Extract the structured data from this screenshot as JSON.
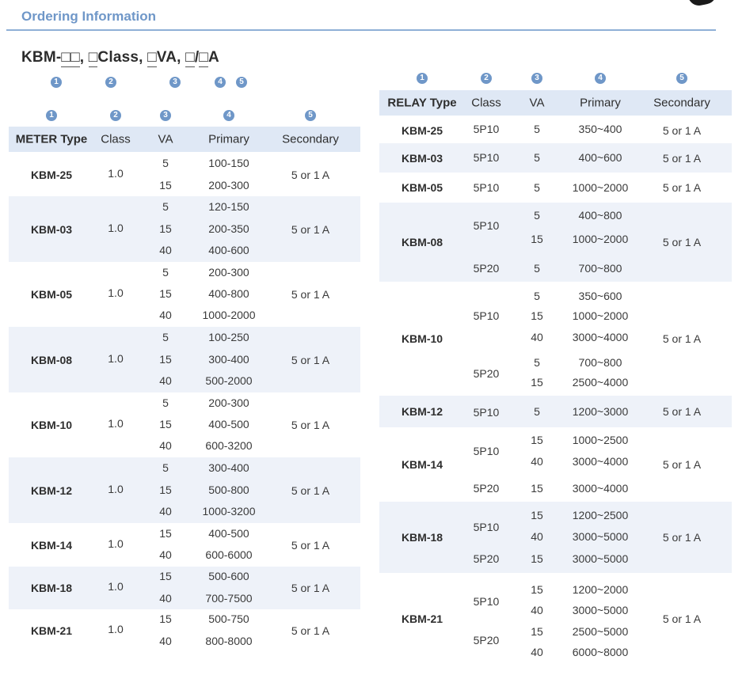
{
  "section_title": "Ordering Information",
  "code": {
    "prefix": "KBM-",
    "boxes_1": "□□",
    "sep_1": ", ",
    "box_2": "□",
    "suffix_2": "Class, ",
    "box_3": "□",
    "suffix_3": "VA, ",
    "box_4": "□",
    "slash": "/",
    "box_5": "□",
    "suffix_5": "A"
  },
  "markers": [
    "1",
    "2",
    "3",
    "4",
    "5"
  ],
  "meter": {
    "headers": [
      "METER Type",
      "Class",
      "VA",
      "Primary",
      "Secondary"
    ],
    "rows": [
      {
        "type": "KBM-25",
        "class": "1.0",
        "va": [
          "5",
          "15"
        ],
        "primary": [
          "100-150",
          "200-300"
        ],
        "secondary": "5 or 1 A"
      },
      {
        "type": "KBM-03",
        "class": "1.0",
        "va": [
          "5",
          "15",
          "40"
        ],
        "primary": [
          "120-150",
          "200-350",
          "400-600"
        ],
        "secondary": "5 or 1 A"
      },
      {
        "type": "KBM-05",
        "class": "1.0",
        "va": [
          "5",
          "15",
          "40"
        ],
        "primary": [
          "200-300",
          "400-800",
          "1000-2000"
        ],
        "secondary": "5 or 1 A"
      },
      {
        "type": "KBM-08",
        "class": "1.0",
        "va": [
          "5",
          "15",
          "40"
        ],
        "primary": [
          "100-250",
          "300-400",
          "500-2000"
        ],
        "secondary": "5 or 1 A"
      },
      {
        "type": "KBM-10",
        "class": "1.0",
        "va": [
          "5",
          "15",
          "40"
        ],
        "primary": [
          "200-300",
          "400-500",
          "600-3200"
        ],
        "secondary": "5 or 1 A"
      },
      {
        "type": "KBM-12",
        "class": "1.0",
        "va": [
          "5",
          "15",
          "40"
        ],
        "primary": [
          "300-400",
          "500-800",
          "1000-3200"
        ],
        "secondary": "5 or 1 A"
      },
      {
        "type": "KBM-14",
        "class": "1.0",
        "va": [
          "15",
          "40"
        ],
        "primary": [
          "400-500",
          "600-6000"
        ],
        "secondary": "5 or 1 A"
      },
      {
        "type": "KBM-18",
        "class": "1.0",
        "va": [
          "15",
          "40"
        ],
        "primary": [
          "500-600",
          "700-7500"
        ],
        "secondary": "5 or 1 A"
      },
      {
        "type": "KBM-21",
        "class": "1.0",
        "va": [
          "15",
          "40"
        ],
        "primary": [
          "500-750",
          "800-8000"
        ],
        "secondary": "5 or 1 A"
      }
    ]
  },
  "relay": {
    "headers": [
      "RELAY Type",
      "Class",
      "VA",
      "Primary",
      "Secondary"
    ],
    "rows": [
      {
        "type": "KBM-25",
        "secondary": "5 or 1 A",
        "groups": [
          {
            "class": "5P10",
            "va": [
              "5"
            ],
            "primary": [
              "350~400"
            ]
          }
        ]
      },
      {
        "type": "KBM-03",
        "secondary": "5 or 1 A",
        "groups": [
          {
            "class": "5P10",
            "va": [
              "5"
            ],
            "primary": [
              "400~600"
            ]
          }
        ]
      },
      {
        "type": "KBM-05",
        "secondary": "5 or 1 A",
        "groups": [
          {
            "class": "5P10",
            "va": [
              "5"
            ],
            "primary": [
              "1000~2000"
            ]
          }
        ]
      },
      {
        "type": "KBM-08",
        "secondary": "5 or 1 A",
        "groups": [
          {
            "class": "5P10",
            "va": [
              "5",
              "15"
            ],
            "primary": [
              "400~800",
              "1000~2000"
            ]
          },
          {
            "class": "5P20",
            "va": [
              "5"
            ],
            "primary": [
              "700~800"
            ]
          }
        ]
      },
      {
        "type": "KBM-10",
        "secondary": "5 or 1 A",
        "groups": [
          {
            "class": "5P10",
            "va": [
              "5",
              "15",
              "40"
            ],
            "primary": [
              "350~600",
              "1000~2000",
              "3000~4000"
            ]
          },
          {
            "class": "5P20",
            "va": [
              "5",
              "15"
            ],
            "primary": [
              "700~800",
              "2500~4000"
            ]
          }
        ]
      },
      {
        "type": "KBM-12",
        "secondary": "5 or 1 A",
        "groups": [
          {
            "class": "5P10",
            "va": [
              "5"
            ],
            "primary": [
              "1200~3000"
            ]
          }
        ]
      },
      {
        "type": "KBM-14",
        "secondary": "5 or 1 A",
        "groups": [
          {
            "class": "5P10",
            "va": [
              "15",
              "40"
            ],
            "primary": [
              "1000~2500",
              "3000~4000"
            ]
          },
          {
            "class": "5P20",
            "va": [
              "15"
            ],
            "primary": [
              "3000~4000"
            ]
          }
        ]
      },
      {
        "type": "KBM-18",
        "secondary": "5 or 1 A",
        "groups": [
          {
            "class": "5P10",
            "va": [
              "15",
              "40"
            ],
            "primary": [
              "1200~2500",
              "3000~5000"
            ]
          },
          {
            "class": "5P20",
            "va": [
              "15"
            ],
            "primary": [
              "3000~5000"
            ]
          }
        ]
      },
      {
        "type": "KBM-21",
        "secondary": "5 or 1 A",
        "groups": [
          {
            "class": "5P10",
            "va": [
              "15",
              "40"
            ],
            "primary": [
              "1200~2000",
              "3000~5000"
            ]
          },
          {
            "class": "5P20",
            "va": [
              "15",
              "40"
            ],
            "primary": [
              "2500~5000",
              "6000~8000"
            ]
          }
        ]
      }
    ]
  }
}
